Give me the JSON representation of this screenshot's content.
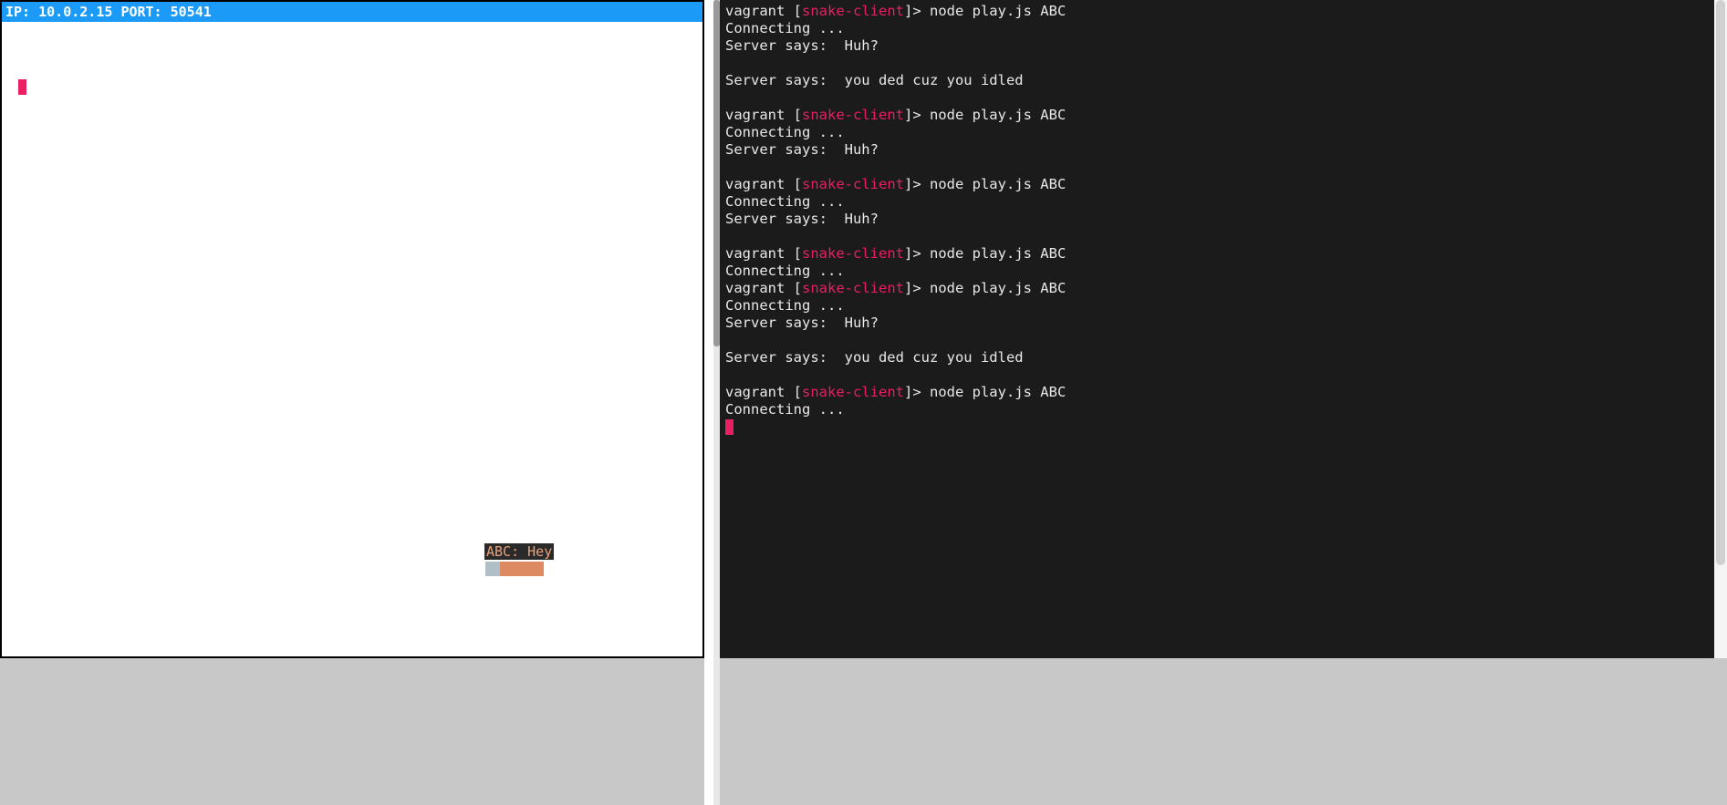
{
  "status_bar": {
    "ip_label": "IP:",
    "ip_value": "10.0.2.15",
    "port_label": "PORT:",
    "port_value": "50541"
  },
  "game": {
    "player_label": "ABC: Hey"
  },
  "terminal": {
    "prompt_user": "vagrant",
    "prompt_open": " [",
    "prompt_dir": "snake-client",
    "prompt_close": "]> ",
    "command": "node play.js ABC",
    "connecting": "Connecting ...",
    "server_huh": "Server says:  Huh?",
    "server_ded": "Server says:  you ded cuz you idled",
    "blank": " "
  },
  "terminal_lines": [
    {
      "type": "prompt"
    },
    {
      "type": "text",
      "key": "connecting"
    },
    {
      "type": "text",
      "key": "server_huh"
    },
    {
      "type": "text",
      "key": "blank"
    },
    {
      "type": "text",
      "key": "server_ded"
    },
    {
      "type": "text",
      "key": "blank"
    },
    {
      "type": "prompt"
    },
    {
      "type": "text",
      "key": "connecting"
    },
    {
      "type": "text",
      "key": "server_huh"
    },
    {
      "type": "text",
      "key": "blank"
    },
    {
      "type": "prompt"
    },
    {
      "type": "text",
      "key": "connecting"
    },
    {
      "type": "text",
      "key": "server_huh"
    },
    {
      "type": "text",
      "key": "blank"
    },
    {
      "type": "prompt"
    },
    {
      "type": "text",
      "key": "connecting"
    },
    {
      "type": "prompt"
    },
    {
      "type": "text",
      "key": "connecting"
    },
    {
      "type": "text",
      "key": "server_huh"
    },
    {
      "type": "text",
      "key": "blank"
    },
    {
      "type": "text",
      "key": "server_ded"
    },
    {
      "type": "text",
      "key": "blank"
    },
    {
      "type": "prompt"
    },
    {
      "type": "text",
      "key": "connecting"
    },
    {
      "type": "cursor"
    }
  ]
}
